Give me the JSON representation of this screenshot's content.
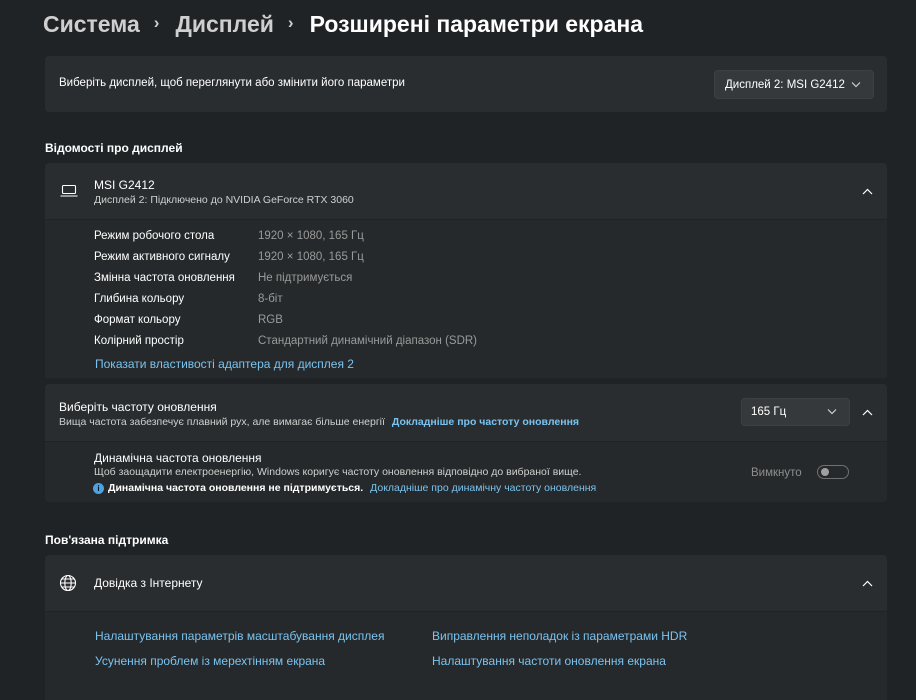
{
  "breadcrumb": {
    "items": [
      "Система",
      "Дисплей",
      "Розширені параметри екрана"
    ],
    "separator": "›"
  },
  "display_select": {
    "label": "Виберіть дисплей, щоб переглянути або змінити його параметри",
    "value": "Дисплей 2: MSI G2412"
  },
  "display_info": {
    "section_title": "Відомості про дисплей",
    "name": "MSI G2412",
    "subtitle": "Дисплей 2: Підключено до NVIDIA GeForce RTX 3060",
    "properties": [
      {
        "label": "Режим робочого стола",
        "value": "1920 × 1080, 165 Гц"
      },
      {
        "label": "Режим активного сигналу",
        "value": "1920 × 1080, 165 Гц"
      },
      {
        "label": "Змінна частота оновлення",
        "value": "Не підтримується"
      },
      {
        "label": "Глибина кольору",
        "value": "8-біт"
      },
      {
        "label": "Формат кольору",
        "value": "RGB"
      },
      {
        "label": "Колірний простір",
        "value": "Стандартний динамічний діапазон (SDR)"
      }
    ],
    "adapter_link": "Показати властивості адаптера для дисплея 2"
  },
  "refresh_rate": {
    "title": "Виберіть частоту оновлення",
    "description": "Вища частота забезпечує плавний рух, але вимагає більше енергії",
    "more_link": "Докладніше про частоту оновлення",
    "value": "165 Гц"
  },
  "dynamic_refresh": {
    "title": "Динамічна частота оновлення",
    "description": "Щоб заощадити електроенергію, Windows коригує частоту оновлення відповідно до вибраної вище.",
    "warning": "Динамічна частота оновлення не підтримується.",
    "more_link": "Докладніше про динамічну частоту оновлення",
    "toggle_label": "Вимкнуто",
    "toggle_on": false
  },
  "related": {
    "section_title": "Пов'язана підтримка",
    "help_title": "Довідка з Інтернету",
    "links": [
      "Налаштування параметрів масштабування дисплея",
      "Виправлення неполадок із параметрами HDR",
      "Усунення проблем із мерехтінням екрана",
      "Налаштування частоти оновлення екрана"
    ]
  },
  "colors": {
    "background": "#1f2326",
    "card": "#2a2d30",
    "accent_link": "#7ac3ef",
    "info": "#4ba3e3"
  }
}
